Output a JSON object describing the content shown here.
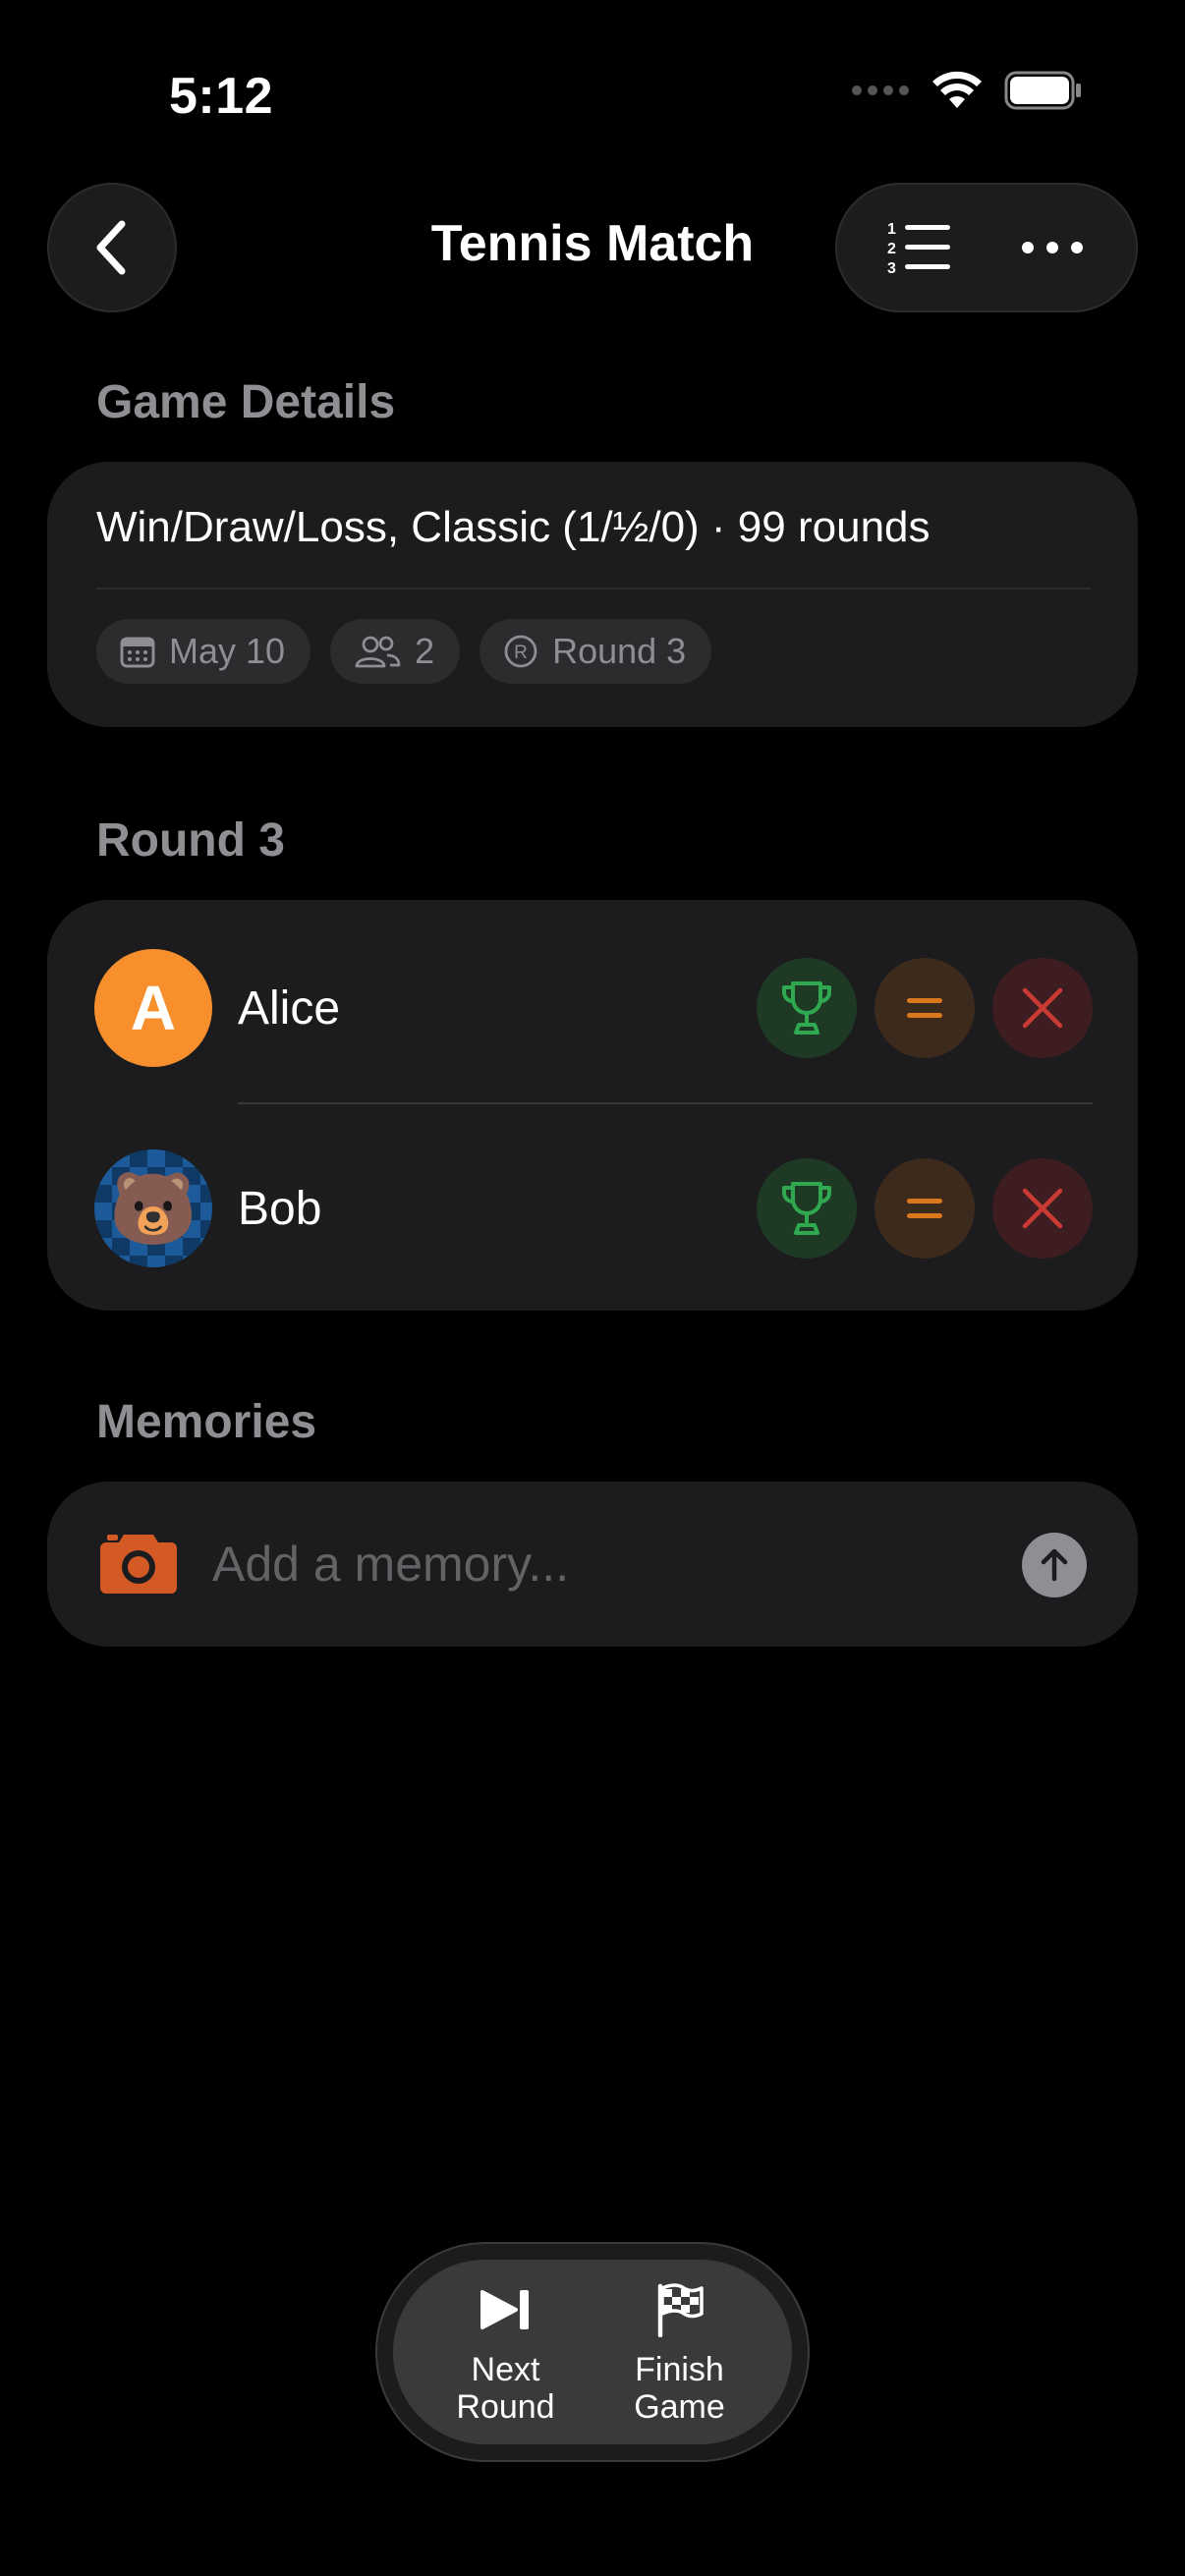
{
  "status_bar": {
    "time": "5:12"
  },
  "nav": {
    "title": "Tennis Match"
  },
  "game_details": {
    "section_label": "Game Details",
    "summary": "Win/Draw/Loss, Classic (1/½/0) · 99 rounds",
    "chips": [
      {
        "icon": "calendar-icon",
        "label": "May 10"
      },
      {
        "icon": "people-icon",
        "label": "2"
      },
      {
        "icon": "round-r-icon",
        "label": "Round 3"
      }
    ]
  },
  "round": {
    "section_label": "Round 3",
    "players": [
      {
        "name": "Alice",
        "avatar_initial": "A",
        "avatar_color": "#f7902c"
      },
      {
        "name": "Bob",
        "avatar_emoji": "🐻"
      }
    ]
  },
  "memories": {
    "section_label": "Memories",
    "placeholder": "Add a memory..."
  },
  "toolbar": {
    "next_label": "Next\nRound",
    "finish_label": "Finish\nGame"
  },
  "colors": {
    "win": "#2fa84f",
    "draw": "#d9781f",
    "loss": "#c93a34",
    "camera": "#d35a25"
  }
}
